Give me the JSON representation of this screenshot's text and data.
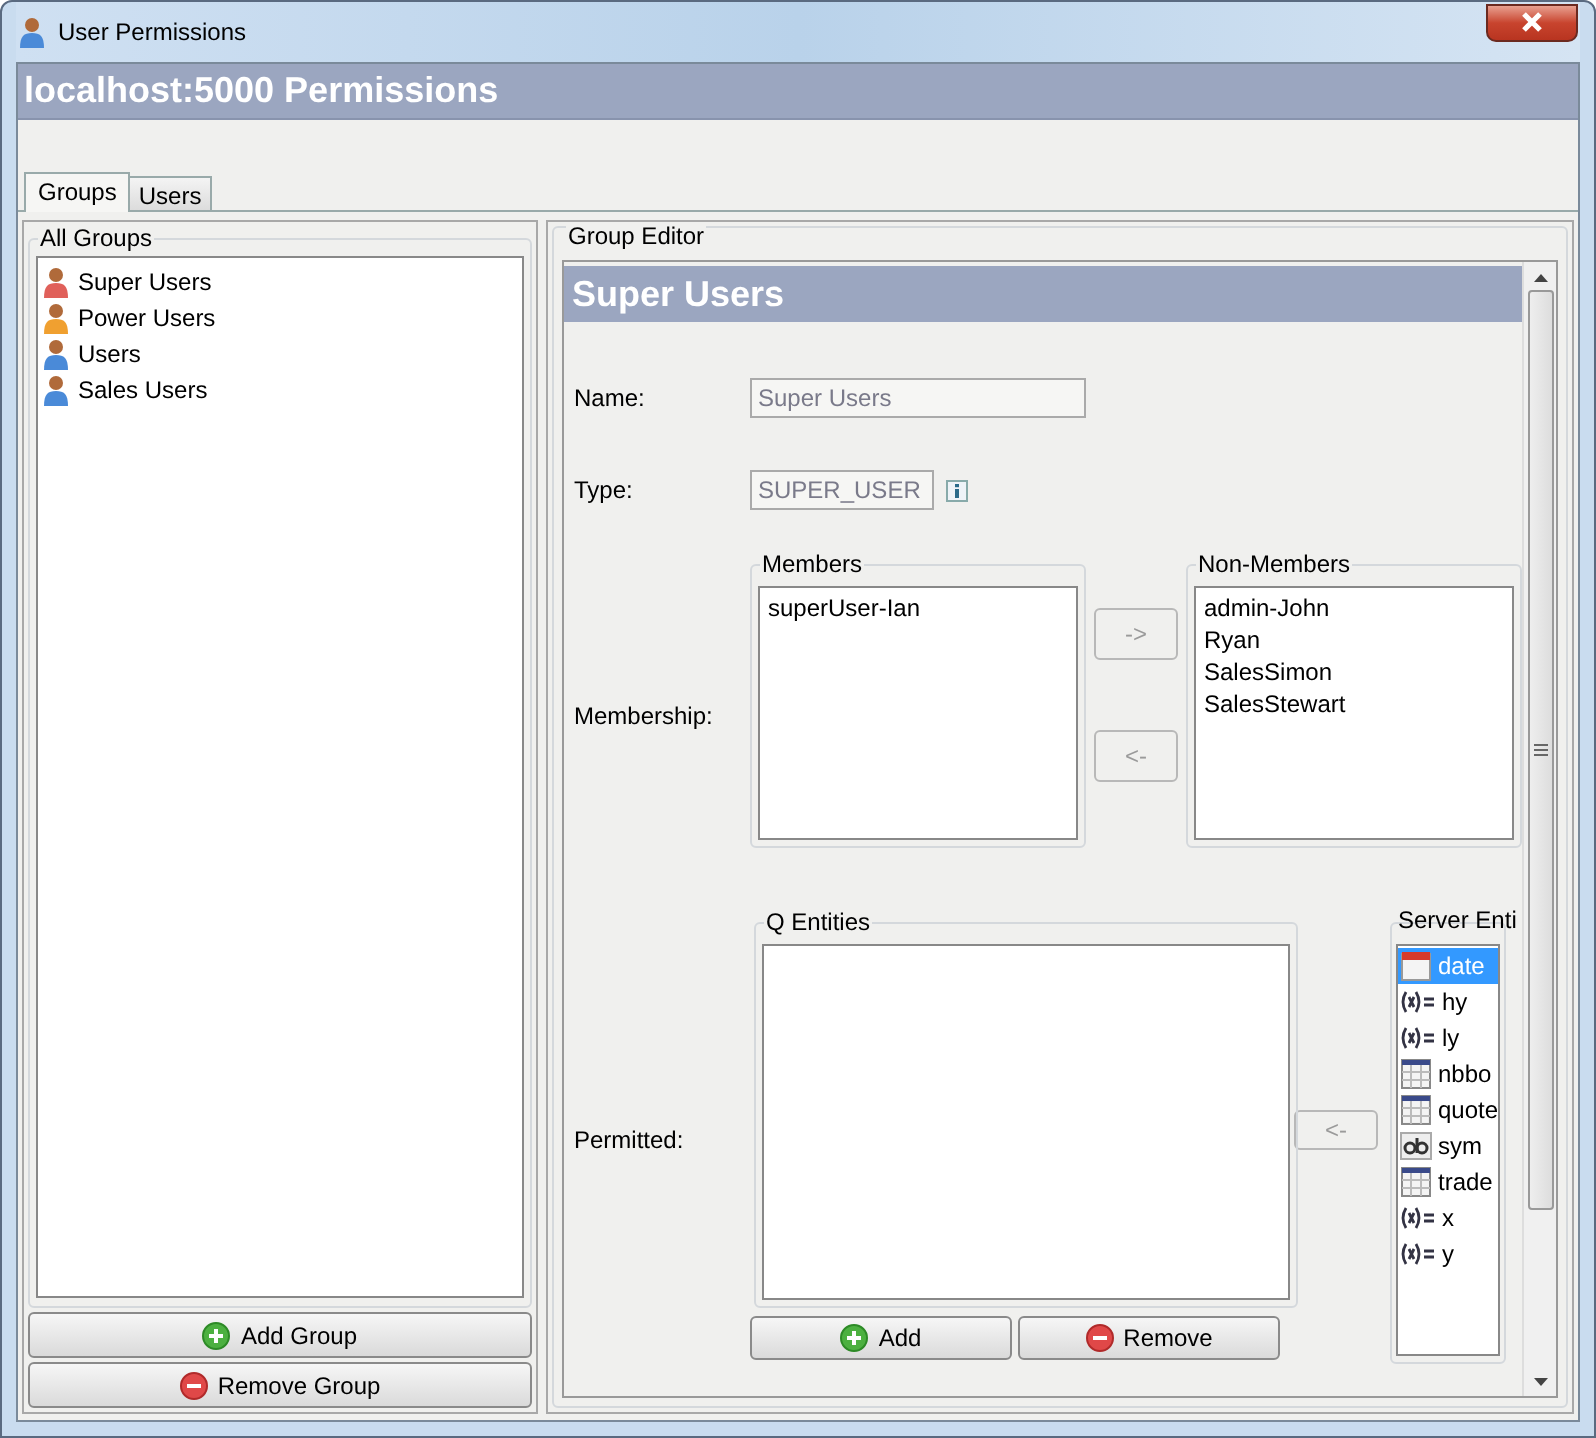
{
  "window": {
    "title": "User Permissions"
  },
  "header": {
    "title": "localhost:5000 Permissions"
  },
  "tabs": [
    {
      "label": "Groups",
      "selected": true
    },
    {
      "label": "Users",
      "selected": false
    }
  ],
  "groups_panel": {
    "title": "All Groups",
    "items": [
      {
        "label": "Super Users",
        "color": "#e0605a"
      },
      {
        "label": "Power Users",
        "color": "#f0a030"
      },
      {
        "label": "Users",
        "color": "#4a8ad8"
      },
      {
        "label": "Sales Users",
        "color": "#4a8ad8"
      }
    ],
    "buttons": [
      {
        "label": "Add Group",
        "kind": "add"
      },
      {
        "label": "Remove Group",
        "kind": "remove"
      }
    ]
  },
  "editor": {
    "title": "Group Editor",
    "heading": "Super Users",
    "name": {
      "label": "Name:",
      "value": "Super Users",
      "disabled": true
    },
    "type": {
      "label": "Type:",
      "value": "SUPER_USER",
      "disabled": true
    },
    "membership": {
      "label": "Membership:",
      "members": {
        "title": "Members",
        "items": [
          "superUser-Ian"
        ]
      },
      "add_button": {
        "label": "->",
        "disabled": true
      },
      "remove_button": {
        "label": "<-",
        "disabled": true
      },
      "non_members": {
        "title": "Non-Members",
        "items": [
          "admin-John",
          "Ryan",
          "SalesSimon",
          "SalesStewart"
        ]
      }
    },
    "permitted": {
      "label": "Permitted:",
      "q_entities": {
        "title": "Q Entities"
      },
      "buttons": [
        {
          "label": "Add",
          "kind": "add"
        },
        {
          "label": "Remove",
          "kind": "remove"
        }
      ],
      "move_button": {
        "label": "<-",
        "disabled": true
      },
      "server_entities": {
        "title": "Server Enti",
        "items": [
          {
            "label": "date",
            "kind": "date",
            "selected": true
          },
          {
            "label": "hy",
            "kind": "variable",
            "selected": false
          },
          {
            "label": "ly",
            "kind": "variable",
            "selected": false
          },
          {
            "label": "nbbo",
            "kind": "table",
            "selected": false
          },
          {
            "label": "quote",
            "kind": "table",
            "selected": false
          },
          {
            "label": "sym",
            "kind": "symbol",
            "selected": false
          },
          {
            "label": "trade",
            "kind": "table",
            "selected": false
          },
          {
            "label": "x",
            "kind": "variable",
            "selected": false
          },
          {
            "label": "y",
            "kind": "variable",
            "selected": false
          }
        ]
      }
    }
  }
}
